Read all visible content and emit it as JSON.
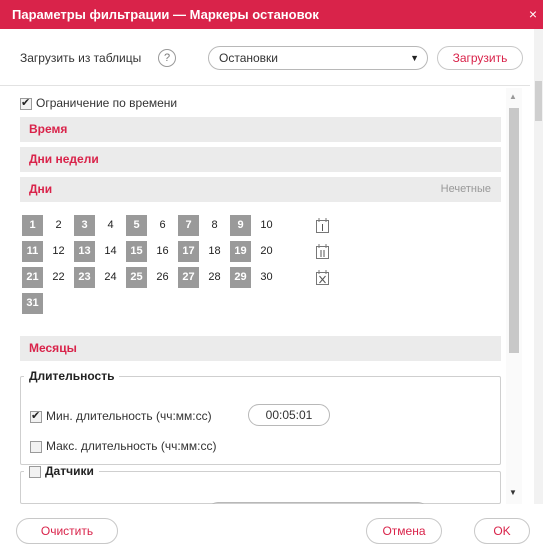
{
  "dialog": {
    "title": "Параметры фильтрации — Маркеры остановок",
    "close": "×"
  },
  "load": {
    "label": "Загрузить из таблицы",
    "help": "?",
    "select_value": "Остановки",
    "button": "Загрузить"
  },
  "time_limit": {
    "label": "Ограничение по времени",
    "checked": true
  },
  "sections": {
    "time": "Время",
    "weekdays": "Дни недели",
    "days": "Дни",
    "days_right": "Нечетные",
    "months": "Месяцы"
  },
  "days": [
    {
      "n": "1",
      "sel": true
    },
    {
      "n": "2",
      "sel": false
    },
    {
      "n": "3",
      "sel": true
    },
    {
      "n": "4",
      "sel": false
    },
    {
      "n": "5",
      "sel": true
    },
    {
      "n": "6",
      "sel": false
    },
    {
      "n": "7",
      "sel": true
    },
    {
      "n": "8",
      "sel": false
    },
    {
      "n": "9",
      "sel": true
    },
    {
      "n": "10",
      "sel": false
    },
    {
      "n": "11",
      "sel": true
    },
    {
      "n": "12",
      "sel": false
    },
    {
      "n": "13",
      "sel": true
    },
    {
      "n": "14",
      "sel": false
    },
    {
      "n": "15",
      "sel": true
    },
    {
      "n": "16",
      "sel": false
    },
    {
      "n": "17",
      "sel": true
    },
    {
      "n": "18",
      "sel": false
    },
    {
      "n": "19",
      "sel": true
    },
    {
      "n": "20",
      "sel": false
    },
    {
      "n": "21",
      "sel": true
    },
    {
      "n": "22",
      "sel": false
    },
    {
      "n": "23",
      "sel": true
    },
    {
      "n": "24",
      "sel": false
    },
    {
      "n": "25",
      "sel": true
    },
    {
      "n": "26",
      "sel": false
    },
    {
      "n": "27",
      "sel": true
    },
    {
      "n": "28",
      "sel": false
    },
    {
      "n": "29",
      "sel": true
    },
    {
      "n": "30",
      "sel": false
    },
    {
      "n": "31",
      "sel": true
    }
  ],
  "duration": {
    "legend": "Длительность",
    "min_label": "Мин. длительность (чч:мм:сс)",
    "min_checked": true,
    "min_value": "00:05:01",
    "max_label": "Макс. длительность (чч:мм:сс)",
    "max_checked": false
  },
  "sensors": {
    "legend": "Датчики",
    "checked": false
  },
  "footer": {
    "clear": "Очистить",
    "cancel": "Отмена",
    "ok": "OK"
  },
  "colors": {
    "accent": "#d9234a",
    "odd_day": "#9a9a9a",
    "section_bg": "#ebebeb"
  },
  "icons": [
    "odd-days-calendar-icon",
    "even-days-calendar-icon",
    "clear-days-calendar-icon"
  ]
}
